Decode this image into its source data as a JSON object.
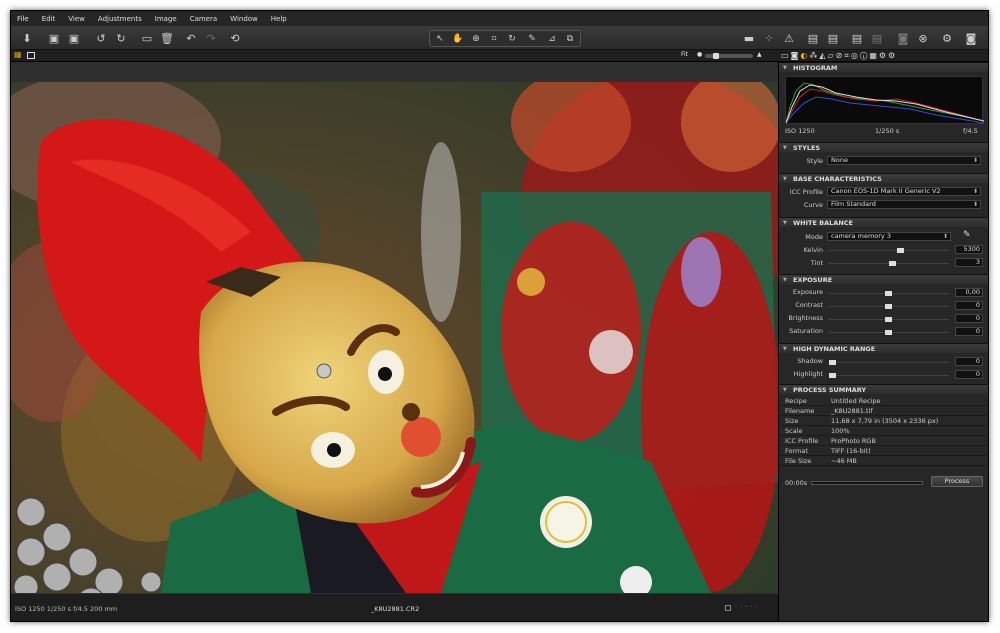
{
  "menu": [
    "File",
    "Edit",
    "View",
    "Adjustments",
    "Image",
    "Camera",
    "Window",
    "Help"
  ],
  "viewer": {
    "fit_label": "Fit"
  },
  "status": {
    "exif": "ISO 1250   1/250 s   f/4.5   200 mm",
    "filename": "_K8U2881.CR2"
  },
  "panel": {
    "histogram": {
      "title": "HISTOGRAM",
      "iso": "ISO 1250",
      "shutter": "1/250 s",
      "aperture": "f/4.5"
    },
    "styles": {
      "title": "STYLES",
      "style_label": "Style",
      "style_value": "None"
    },
    "base": {
      "title": "BASE CHARACTERISTICS",
      "icc_label": "ICC Profile",
      "icc_value": "Canon EOS-1D Mark II Generic V2",
      "curve_label": "Curve",
      "curve_value": "Film Standard"
    },
    "wb": {
      "title": "WHITE BALANCE",
      "mode_label": "Mode",
      "mode_value": "camera memory 3",
      "kelvin_label": "Kelvin",
      "kelvin_value": "5300",
      "tint_label": "Tint",
      "tint_value": "3"
    },
    "exposure": {
      "title": "EXPOSURE",
      "rows": [
        {
          "label": "Exposure",
          "value": "0,00"
        },
        {
          "label": "Contrast",
          "value": "0"
        },
        {
          "label": "Brightness",
          "value": "0"
        },
        {
          "label": "Saturation",
          "value": "0"
        }
      ]
    },
    "hdr": {
      "title": "HIGH DYNAMIC RANGE",
      "rows": [
        {
          "label": "Shadow",
          "value": "0"
        },
        {
          "label": "Highlight",
          "value": "0"
        }
      ]
    },
    "summary": {
      "title": "PROCESS SUMMARY",
      "rows": [
        {
          "key": "Recipe",
          "value": "Untitled Recipe"
        },
        {
          "key": "Filename",
          "value": "_K8U2881.tif"
        },
        {
          "key": "Size",
          "value": "11,68 x 7,79  in  (3504 x 2336  px)"
        },
        {
          "key": "Scale",
          "value": "100%"
        },
        {
          "key": "ICC Profile",
          "value": "ProPhoto RGB"
        },
        {
          "key": "Format",
          "value": "TIFF (16-bit)"
        },
        {
          "key": "File Size",
          "value": "~46 MB"
        }
      ]
    },
    "process": {
      "time": "00:00s",
      "button": "Process"
    }
  }
}
